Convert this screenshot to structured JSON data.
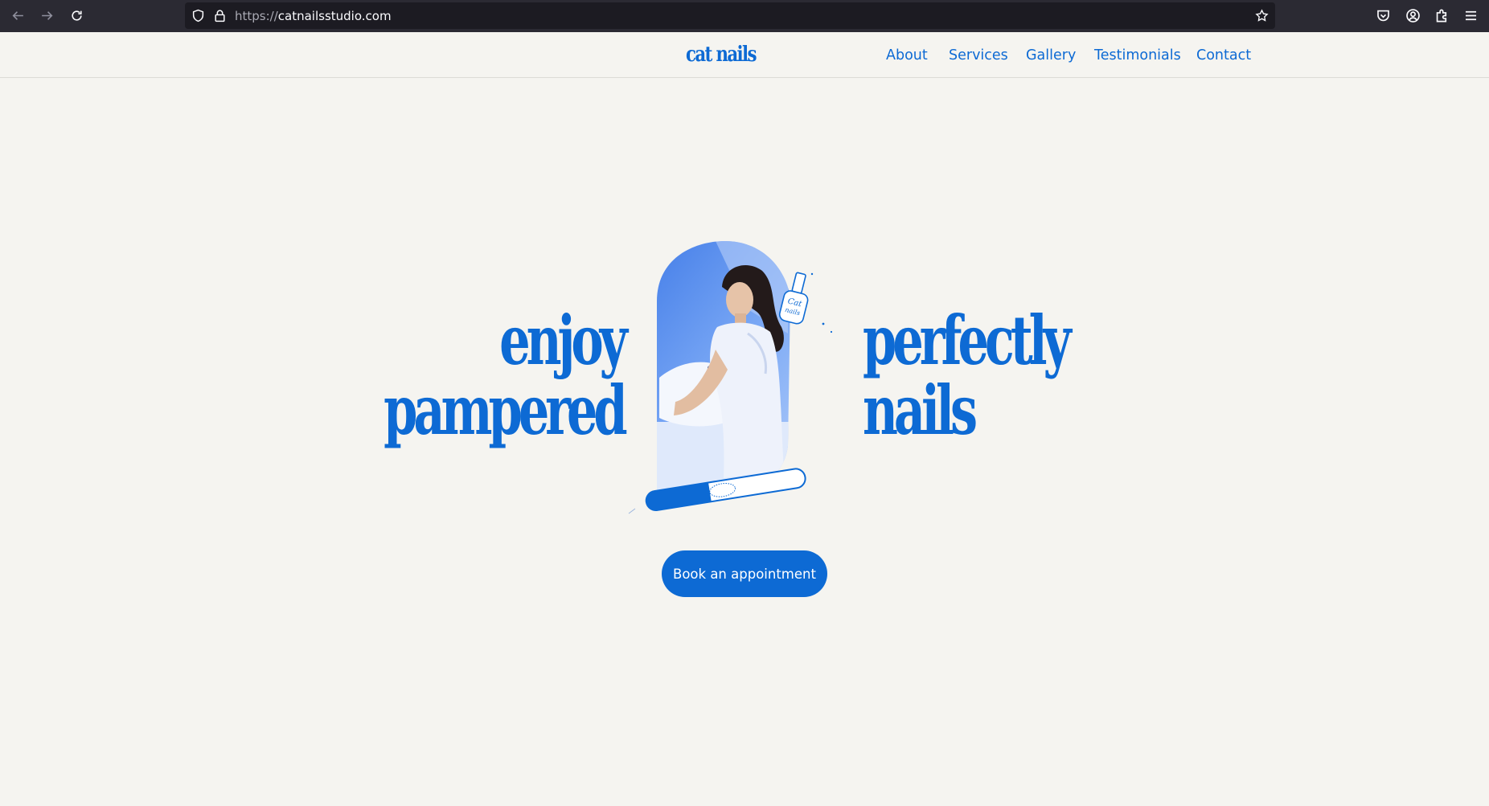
{
  "browser": {
    "url_scheme": "https://",
    "url_host": "catnailsstudio.com",
    "icons": [
      "back-icon",
      "forward-icon",
      "reload-icon",
      "shield-icon",
      "lock-icon",
      "star-icon",
      "pocket-icon",
      "account-icon",
      "extensions-icon",
      "menu-icon"
    ]
  },
  "header": {
    "logo": "cat nails",
    "nav": [
      {
        "label": "About"
      },
      {
        "label": "Services"
      },
      {
        "label": "Gallery"
      },
      {
        "label": "Testimonials"
      },
      {
        "label": "Contact"
      }
    ]
  },
  "hero": {
    "left_line1": "enjoy",
    "left_line2": "pampered",
    "right_line1": "perfectly",
    "right_line2": "nails",
    "bottle_label_line1": "Cat",
    "bottle_label_line2": "nails",
    "cta_label": "Book an appointment"
  },
  "colors": {
    "brand_blue": "#0d6ad4",
    "page_bg": "#f5f4f0",
    "chrome_bg": "#2b2a33"
  }
}
